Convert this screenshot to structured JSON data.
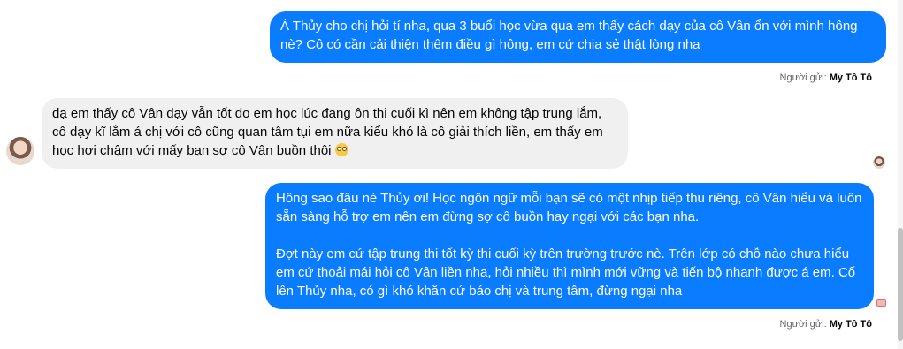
{
  "messages": [
    {
      "direction": "outgoing",
      "text": "À Thủy cho chị hỏi tí nha, qua 3 buổi học vừa qua em thấy cách dạy của cô Vân ổn với mình hông nè? Cô có cần cải thiện thêm điều gì hông, em cứ chia sẻ thật lòng nha",
      "sender_prefix": "Người gửi:",
      "sender_name": "My Tô Tô"
    },
    {
      "direction": "incoming",
      "text": "dạ em thấy cô Vân dạy vẫn tốt do em học lúc đang ôn thi cuối kì nên em không tập trung lắm, cô dạy kĩ lắm á chị với cô cũng quan tâm tụi em nữa kiểu khó là cô giải thích liền, em thấy em học hơi chậm với mấy bạn sợ cô Vân buồn thôi",
      "emoji": "pleading-face-emoji"
    },
    {
      "direction": "outgoing",
      "paragraph1": "Hông sao đâu nè Thủy ơi! Học ngôn ngữ mỗi bạn sẽ có một nhịp tiếp thu riêng, cô Vân hiểu và luôn sẵn sàng hỗ trợ em nên em đừng sợ cô buồn hay ngại với các bạn nha.",
      "paragraph2": "Đợt này em cứ tập trung thi tốt kỳ thi cuối kỳ trên trường trước nè. Trên lớp có chỗ nào chưa hiểu em cứ thoải mái hỏi cô Vân liền nha, hỏi nhiều thì mình mới vững và tiến bộ nhanh được á em. Cố lên Thủy nha, có gì khó khăn cứ báo chị và trung tâm, đừng ngại nha",
      "sender_prefix": "Người gửi:",
      "sender_name": "My Tô Tô"
    }
  ],
  "colors": {
    "outgoing_bubble": "#0a7cff",
    "incoming_bubble": "#f0f0f0"
  }
}
